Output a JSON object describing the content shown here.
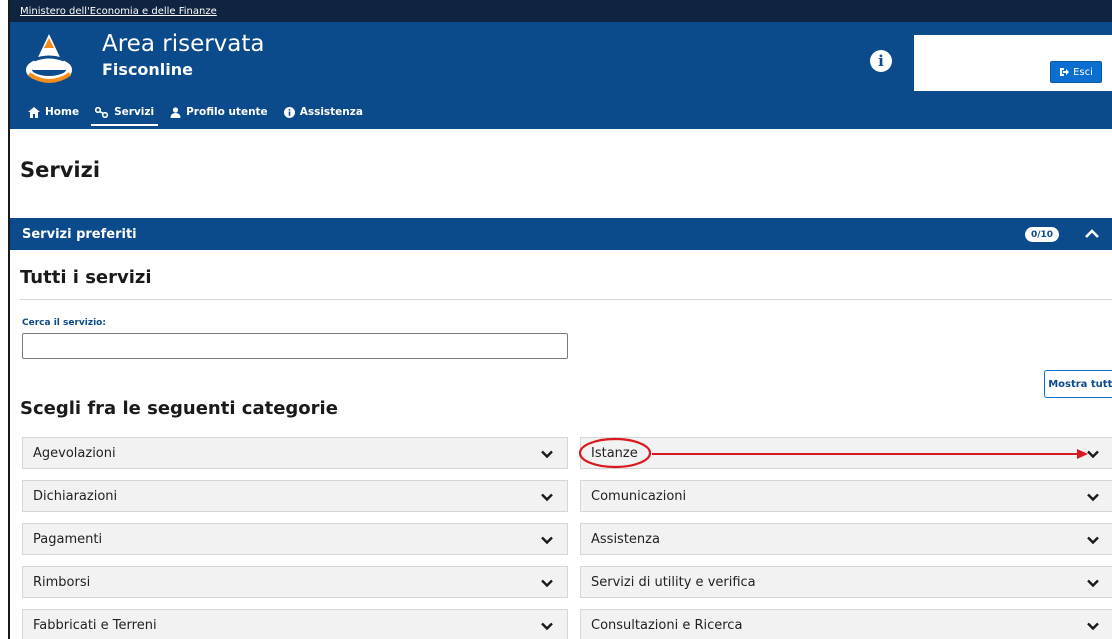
{
  "top_strip": {
    "ministry_link": "Ministero dell'Economia e delle Finanze"
  },
  "header": {
    "title": "Area riservata",
    "subtitle": "Fisconline",
    "info_icon": "info-icon",
    "logout_label": "Esci"
  },
  "nav": {
    "items": [
      {
        "label": "Home",
        "icon": "home-icon"
      },
      {
        "label": "Servizi",
        "icon": "services-icon",
        "active": true
      },
      {
        "label": "Profilo utente",
        "icon": "user-icon"
      },
      {
        "label": "Assistenza",
        "icon": "info-icon"
      }
    ]
  },
  "page": {
    "title": "Servizi",
    "favorites_label": "Servizi preferiti",
    "favorites_count": "0/10",
    "all_services_title": "Tutti i servizi",
    "search_label": "Cerca il servizio:",
    "search_value": "",
    "show_all_label": "Mostra tutti",
    "categories_title": "Scegli fra le seguenti categorie"
  },
  "categories": {
    "left": [
      "Agevolazioni",
      "Dichiarazioni",
      "Pagamenti",
      "Rimborsi",
      "Fabbricati e Terreni"
    ],
    "right": [
      "Istanze",
      "Comunicazioni",
      "Assistenza",
      "Servizi di utility e verifica",
      "Consultazioni e Ricerca"
    ]
  },
  "colors": {
    "brand_blue": "#0b4a8b",
    "dark_strip": "#0f2440",
    "annotation_red": "#d9181f"
  }
}
